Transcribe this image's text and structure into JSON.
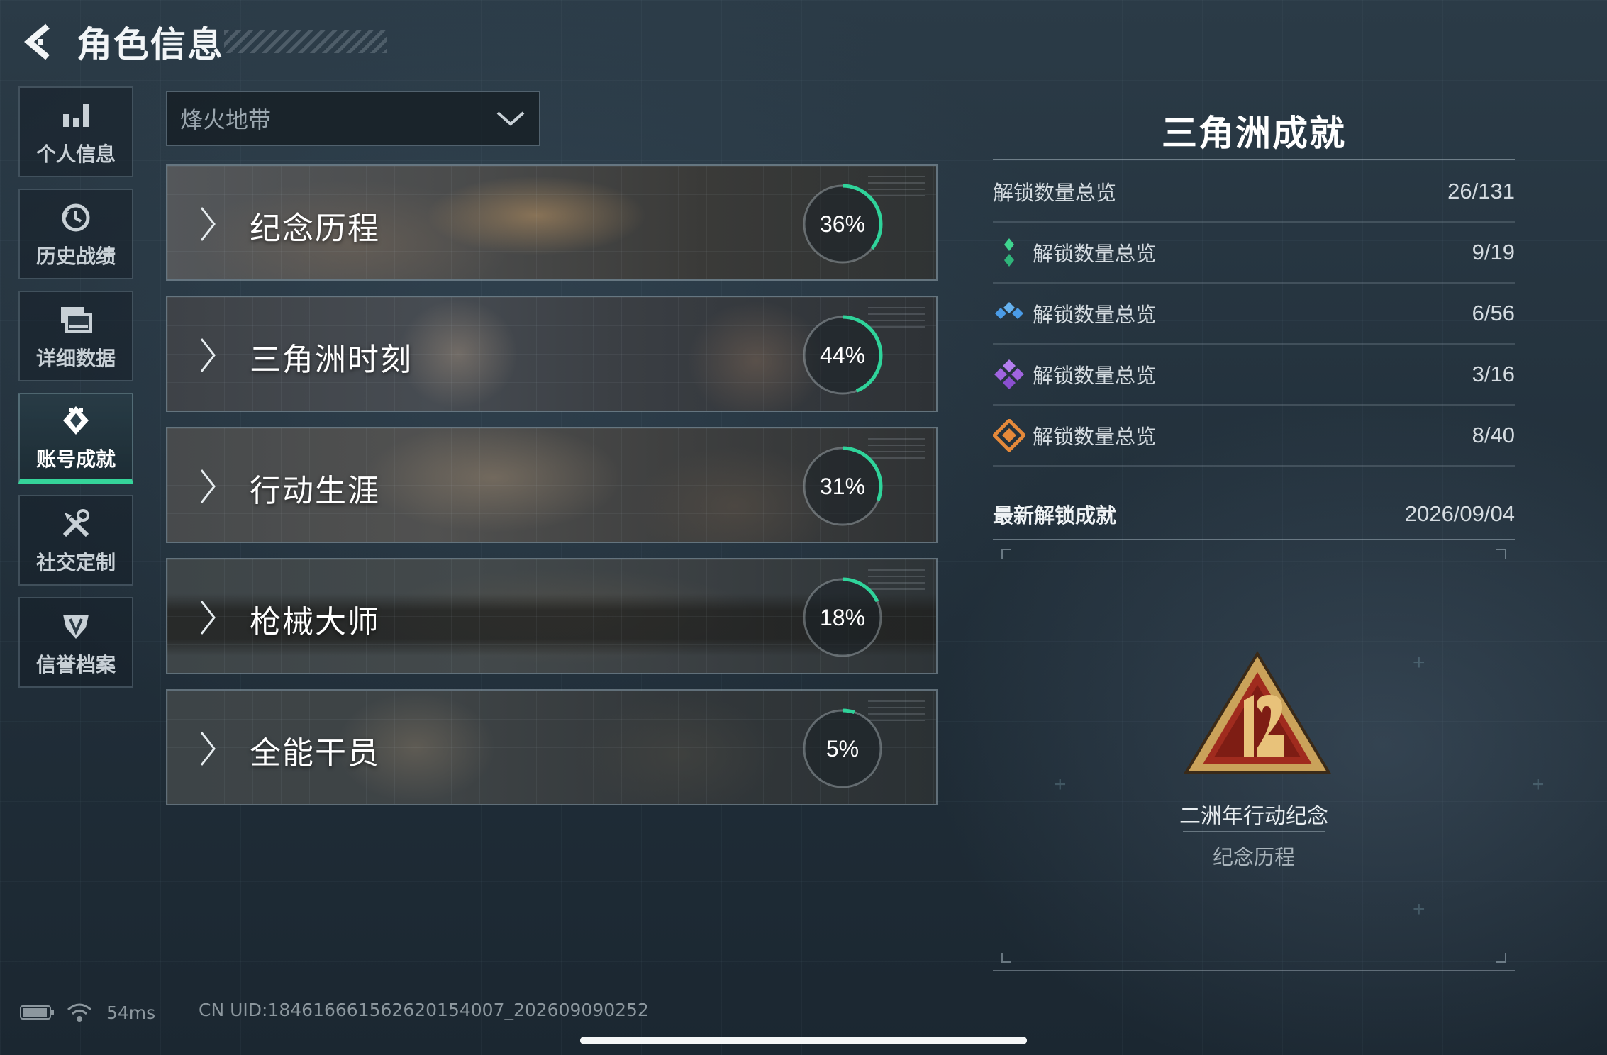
{
  "header": {
    "title": "角色信息"
  },
  "sidebar": {
    "items": [
      {
        "label": "个人信息",
        "icon": "bar-chart-icon",
        "active": false
      },
      {
        "label": "历史战绩",
        "icon": "history-clock-icon",
        "active": false
      },
      {
        "label": "详细数据",
        "icon": "data-cards-icon",
        "active": false
      },
      {
        "label": "账号成就",
        "icon": "achievement-badge-icon",
        "active": true
      },
      {
        "label": "社交定制",
        "icon": "tools-icon",
        "active": false
      },
      {
        "label": "信誉档案",
        "icon": "shield-badge-icon",
        "active": false
      }
    ]
  },
  "mode_select": {
    "value": "烽火地带"
  },
  "categories": [
    {
      "name": "纪念历程",
      "percent": "36%",
      "progress": 0.36
    },
    {
      "name": "三角洲时刻",
      "percent": "44%",
      "progress": 0.44
    },
    {
      "name": "行动生涯",
      "percent": "31%",
      "progress": 0.31
    },
    {
      "name": "枪械大师",
      "percent": "18%",
      "progress": 0.18
    },
    {
      "name": "全能干员",
      "percent": "5%",
      "progress": 0.05
    }
  ],
  "panel": {
    "title": "三角洲成就",
    "total": {
      "label": "解锁数量总览",
      "value": "26/131"
    },
    "tiers": [
      {
        "label": "解锁数量总览",
        "value": "9/19",
        "color": "#3fd58f",
        "icon": "green-gem-icon"
      },
      {
        "label": "解锁数量总览",
        "value": "6/56",
        "color": "#4a9be6",
        "icon": "blue-gem-icon"
      },
      {
        "label": "解锁数量总览",
        "value": "3/16",
        "color": "#a064e0",
        "icon": "purple-gem-icon"
      },
      {
        "label": "解锁数量总览",
        "value": "8/40",
        "color": "#e5893a",
        "icon": "orange-gem-icon"
      }
    ],
    "latest": {
      "label": "最新解锁成就",
      "date": "2026/09/04"
    },
    "achievement": {
      "name": "二洲年行动纪念",
      "category": "纪念历程"
    }
  },
  "status_bar": {
    "ping": "54ms",
    "uid": "CN UID:18461666156262015400‍7_202609090252"
  },
  "colors": {
    "accent": "#35d49a",
    "progress": "#2fd39a"
  }
}
